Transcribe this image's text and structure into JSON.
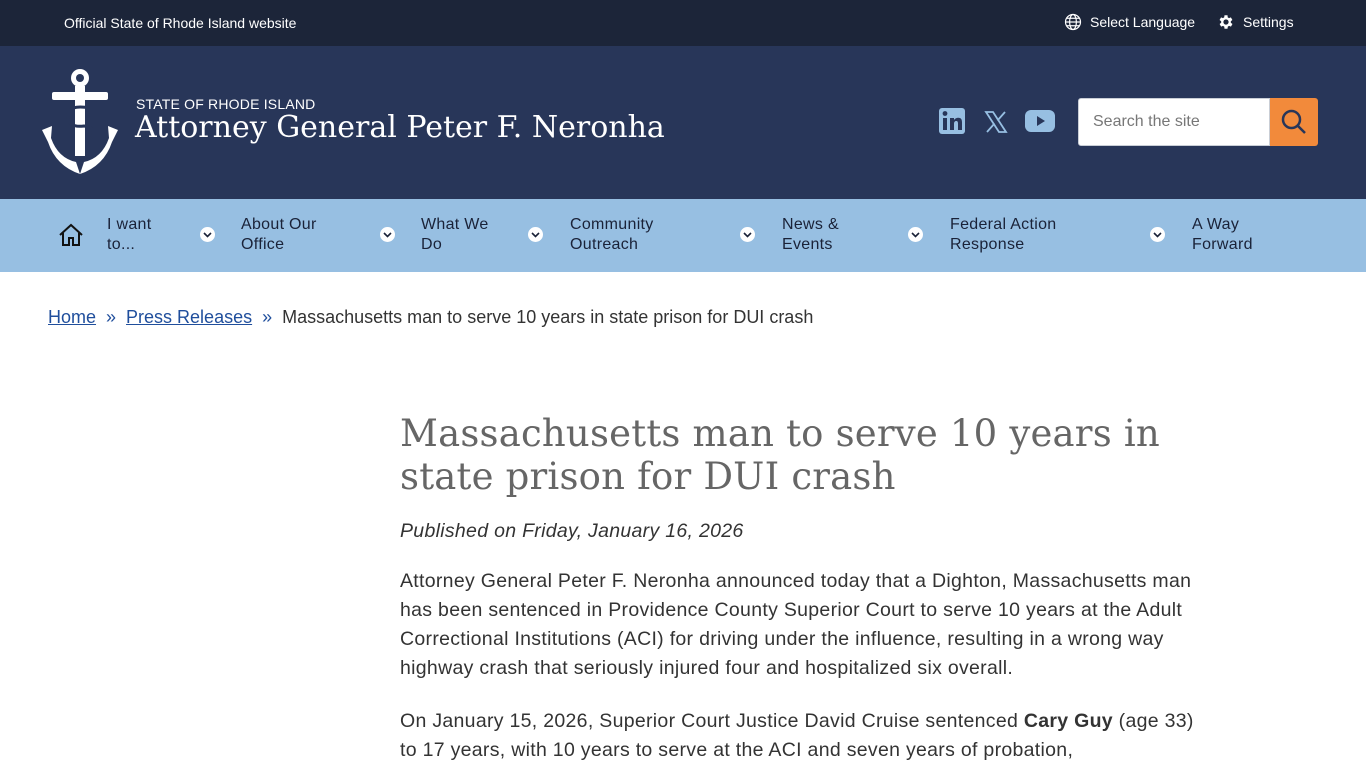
{
  "topbar": {
    "official_text": "Official State of Rhode Island website",
    "language_label": "Select Language",
    "settings_label": "Settings"
  },
  "header": {
    "state_label": "STATE OF RHODE ISLAND",
    "office_title": "Attorney General Peter F. Neronha",
    "social_icons": [
      "linkedin-icon",
      "x-icon",
      "youtube-icon"
    ],
    "search_placeholder": "Search the site"
  },
  "nav": {
    "items": [
      {
        "line1": "I want",
        "line2": "to..."
      },
      {
        "line1": "About Our",
        "line2": "Office"
      },
      {
        "line1": "What We",
        "line2": "Do"
      },
      {
        "line1": "Community",
        "line2": "Outreach"
      },
      {
        "line1": "News &",
        "line2": "Events"
      },
      {
        "line1": "Federal Action",
        "line2": "Response"
      },
      {
        "line1": "A Way",
        "line2": "Forward"
      }
    ]
  },
  "breadcrumb": {
    "home": "Home",
    "sep": "»",
    "press": "Press Releases",
    "current": "Massachusetts man to serve 10 years in state prison for DUI crash"
  },
  "article": {
    "title": "Massachusetts man to serve 10 years in state prison for DUI crash",
    "published": "Published on Friday, January 16, 2026",
    "para1": "Attorney General Peter F. Neronha announced today that a Dighton, Massachusetts man has been sentenced in Providence County Superior Court to serve 10 years at the Adult Correctional Institutions (ACI) for driving under the influence, resulting in a wrong way highway crash that seriously injured four and hospitalized six overall.",
    "para2_start": "On January 15, 2026, Superior Court Justice David Cruise sentenced ",
    "para2_name": "Cary Guy",
    "para2_end": " (age 33) to 17 years, with 10 years to serve at the ACI and seven years of probation,"
  },
  "colors": {
    "topbar_bg": "#1c2539",
    "header_bg": "#283659",
    "nav_bg": "#97bfe2",
    "search_button": "#f28a3b",
    "link": "#1f4e9c"
  }
}
